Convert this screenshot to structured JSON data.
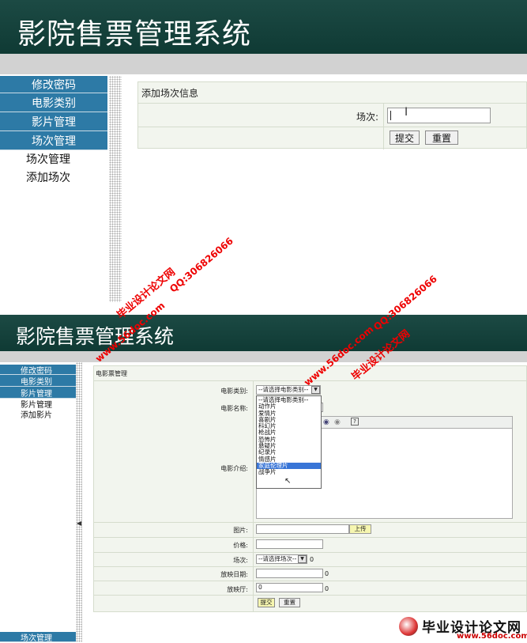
{
  "top": {
    "app_title": "影院售票管理系统",
    "nav": [
      "修改密码",
      "电影类别",
      "影片管理",
      "场次管理"
    ],
    "subnav": [
      "场次管理",
      "添加场次"
    ],
    "form_title": "添加场次信息",
    "field_label": "场次:",
    "submit": "提交",
    "reset": "重置"
  },
  "bottom": {
    "app_title": "影院售票管理系统",
    "nav": [
      "修改密码",
      "电影类别",
      "影片管理"
    ],
    "subnav": [
      "影片管理",
      "添加影片"
    ],
    "footer_nav": "场次管理",
    "form_title": "电影票管理",
    "labels": {
      "category": "电影类别:",
      "name": "电影名称:",
      "intro": "电影介绍:",
      "image": "图片:",
      "price": "价格:",
      "session": "场次:",
      "date": "放映日期:",
      "hall": "放映厅:"
    },
    "category_select": "--请选择电影类别--",
    "category_options": [
      "--请选择电影类别--",
      "动作片",
      "爱情片",
      "喜剧片",
      "科幻片",
      "枪战片",
      "恐怖片",
      "悬疑片",
      "纪录片",
      "情感片",
      "家庭伦理片",
      "战争片"
    ],
    "highlighted_option": "家庭伦理片",
    "upload": "上传",
    "session_select": "--请选择场次--",
    "zero": "0",
    "date_value": "0",
    "hall_value": "0",
    "submit": "提交",
    "reset": "重置"
  },
  "watermarks": {
    "site": "www.56doc.com",
    "brand": "毕业设计论文网",
    "qq": "QQ:306826066",
    "logo_text": "毕业设计论文网",
    "logo_site": "www.56doc.com"
  }
}
